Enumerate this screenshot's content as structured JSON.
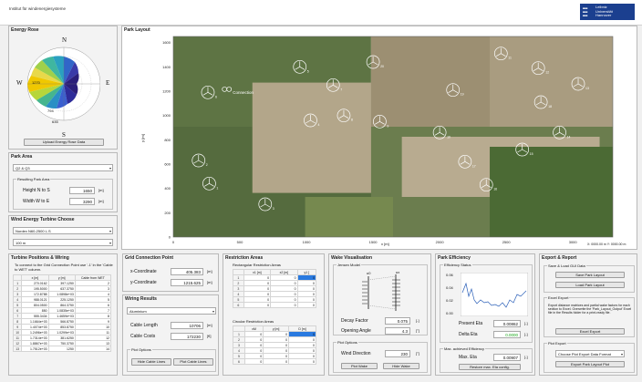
{
  "header": {
    "logo_text": "Institut für windenergiesysteme",
    "uni_name_1": "Leibniz",
    "uni_name_2": "Universität",
    "uni_name_3": "Hannover"
  },
  "energy_rose": {
    "title": "Energy Rose",
    "dirs": {
      "n": "N",
      "s": "S",
      "e": "E",
      "w": "W"
    },
    "rings": [
      "1270",
      "794",
      "635"
    ],
    "button": "Upload Energy Rose Data"
  },
  "park_area": {
    "title": "Park Area",
    "select_value": "Q2 & Q3",
    "group_title": "Resulting Park Area",
    "height_label": "Height  N to S",
    "height_value": "1650",
    "width_label": "Width  W to E",
    "width_value": "3290",
    "unit": "[m]"
  },
  "turbine_choose": {
    "title": "Wind Energy Turbine Choose",
    "model_value": "Nordex N60-2500 L.S",
    "hub_value": "100 m"
  },
  "layout": {
    "title": "Park Layout",
    "ylabel": "y [m]",
    "xlabel": "x [m]",
    "connection_label": "Connection",
    "coord_readout": "X: 0000.00 m  Y: 0000.00 m",
    "turbine_labels": [
      "1",
      "2",
      "3",
      "4",
      "5",
      "6",
      "7",
      "8",
      "9",
      "10",
      "11",
      "12",
      "13",
      "14",
      "15",
      "16",
      "17",
      "18",
      "19",
      "20"
    ]
  },
  "chart_data": {
    "type": "scatter",
    "title": "Park Layout",
    "xlabel": "x [m]",
    "ylabel": "y [m]",
    "xlim": [
      0,
      3300
    ],
    "ylim": [
      0,
      1650
    ],
    "x_ticks": [
      "0",
      "500",
      "1000",
      "1500",
      "2000",
      "2500",
      "3000"
    ],
    "y_ticks": [
      "0",
      "200",
      "400",
      "600",
      "800",
      "1000",
      "1200",
      "1400",
      "1600"
    ],
    "series": [
      {
        "x": [
          270,
          190,
          690,
          1030,
          950,
          260,
          1200,
          1280,
          1550,
          2000,
          2460,
          2740,
          3040,
          2900,
          2620,
          2350,
          2190,
          2760,
          2100,
          1500
        ],
        "y": [
          440,
          630,
          270,
          960,
          1400,
          1190,
          1250,
          1000,
          950,
          860,
          1510,
          1390,
          1260,
          860,
          720,
          430,
          620,
          1110,
          1210,
          1440
        ]
      }
    ]
  },
  "turbine_positions": {
    "title": "Turbine Positions & Wiring",
    "note": "To connect to the Grid Connection Point use '-1' in the 'Cable to WET' column.",
    "columns": [
      "x [m]",
      "y [m]",
      "Cable from WET"
    ],
    "rows": [
      [
        "270.0162",
        "397.1250",
        "2"
      ],
      [
        "195.5000",
        "637.3750",
        "3"
      ],
      [
        "172.8788",
        "1.0898e+03",
        "4"
      ],
      [
        "988.0121",
        "225.1250",
        "5"
      ],
      [
        "804.0500",
        "864.3750",
        "6"
      ],
      [
        "850",
        "1.0835e+03",
        "7"
      ],
      [
        "555.3434",
        "1.4659e+03",
        "8"
      ],
      [
        "1.1664e+03",
        "566.8750",
        "9"
      ],
      [
        "1.4074e+03",
        "853.8750",
        "10"
      ],
      [
        "1.2496e+03",
        "1.0299e+03",
        "11"
      ],
      [
        "1.7314e+03",
        "381.6250",
        "12"
      ],
      [
        "1.8867e+03",
        "750.3750",
        "13"
      ],
      [
        "1.7512e+03",
        "1250",
        "14"
      ]
    ]
  },
  "grid_connection": {
    "title": "Grid Connection Point",
    "x_label": "x-Coordinate",
    "x_value": "405.383",
    "y_label": "y-Coordinate",
    "y_value": "1215.625",
    "unit": "[m]"
  },
  "wiring": {
    "title": "Wiring Results",
    "cable_value": "Aluminium",
    "length_label": "Cable Length",
    "length_value": "10706",
    "length_unit": "[m]",
    "costs_label": "Cable Costs",
    "costs_value": "172230",
    "costs_unit": "[€]",
    "plot_options": "Plot Options",
    "hide_btn": "Hide Cable Lines",
    "plot_btn": "Plot Cable Lines"
  },
  "restriction": {
    "title": "Restriction Areas",
    "rect_title": "Rectangular Restriction Areas",
    "rect_cols": [
      "x1 [m]",
      "x2 [m]",
      "y1 ["
    ],
    "rect_rows": [
      [
        "0",
        "0",
        "0"
      ],
      [
        "0",
        "0",
        "0"
      ],
      [
        "0",
        "0",
        "0"
      ],
      [
        "0",
        "0",
        "0"
      ],
      [
        "0",
        "0",
        "0"
      ],
      [
        "0",
        "0",
        "0"
      ]
    ],
    "circ_title": "Circular Restriction Areas",
    "circ_cols": [
      "xM",
      "y [m]",
      "D [m]"
    ],
    "circ_rows": [
      [
        "0",
        "0",
        "0"
      ],
      [
        "0",
        "0",
        "0"
      ],
      [
        "0",
        "0",
        "0"
      ],
      [
        "0",
        "0",
        "0"
      ],
      [
        "0",
        "0",
        "0"
      ],
      [
        "0",
        "0",
        "0"
      ]
    ]
  },
  "wake": {
    "title": "Wake Visualisation",
    "group": "Jensen Model",
    "u0": "u0",
    "ux": "ux",
    "decay_label": "Decay Factor",
    "decay_value": "0.075",
    "decay_unit": "[-]",
    "angle_label": "Opening Angle",
    "angle_value": "4.3",
    "angle_unit": "[°]",
    "plot_options": "Plot Options",
    "wind_label": "Wind Direction",
    "wind_value": "230",
    "wind_unit": "[°]",
    "plot_btn": "Plot Wake",
    "hide_btn": "Hide Wake"
  },
  "efficiency": {
    "title": "Park Efficiency",
    "status": "Efficiency Status",
    "y_ticks": [
      "0.06",
      "0.04",
      "0.02",
      "0.00"
    ],
    "present_label": "Present Eta",
    "present_value": "0.00862",
    "delta_label": "Delta Eta",
    "delta_value": "0.0000",
    "max_title": "Max. achieved Efficiency",
    "max_label": "Max. Eta",
    "max_value": "0.00907",
    "restore_btn": "Restore max. Eta config.",
    "unit": "[-]"
  },
  "export": {
    "title": "Export & Report",
    "save_group": "Save & Load GUI Data",
    "save_btn": "Save Park Layout",
    "load_btn": "Load Park Layout",
    "excel_group": "Excel Export",
    "excel_text": "Export distance matrices and partial wake factors for each section to Excel. Overwrite the 'Park_Layout_Output' Excel file in the Results folder for a print-ready file.",
    "excel_btn": "Excel Export",
    "plot_group": "Plot Export",
    "format_value": "Choose Plot Export Data Format",
    "export_btn": "Export Park Layout Plot"
  }
}
